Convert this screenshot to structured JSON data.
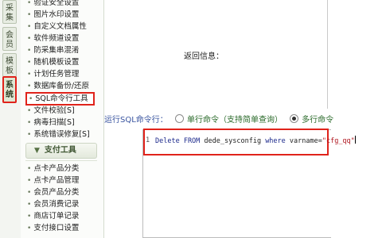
{
  "tabs": [
    {
      "label": "采集"
    },
    {
      "label": "会员"
    },
    {
      "label": "模板"
    },
    {
      "label": "系统",
      "active": true
    }
  ],
  "menu": {
    "system_items": [
      {
        "label": "验证安全设置"
      },
      {
        "label": "图片水印设置"
      },
      {
        "label": "自定义文档属性"
      },
      {
        "label": "软件频道设置"
      },
      {
        "label": "防采集串混淆"
      },
      {
        "label": "随机模板设置"
      },
      {
        "label": "计划任务管理"
      },
      {
        "label": "数据库备份/还原"
      },
      {
        "label": "SQL命令行工具",
        "highlighted": true
      },
      {
        "label": "文件校验[S]"
      },
      {
        "label": "病毒扫描[S]"
      },
      {
        "label": "系统错误修复[S]"
      }
    ],
    "group_title": "支付工具",
    "pay_items": [
      {
        "label": "点卡产品分类"
      },
      {
        "label": "点卡产品管理"
      },
      {
        "label": "会员产品分类"
      },
      {
        "label": "会员消费记录"
      },
      {
        "label": "商店订单记录"
      },
      {
        "label": "支付接口设置"
      }
    ]
  },
  "content": {
    "return_label": "返回信息：",
    "mode_label": "运行SQL命令行：",
    "mode_options": [
      {
        "label": "单行命令（支持简单查询）",
        "selected": false
      },
      {
        "label": "多行命令",
        "selected": true
      }
    ],
    "sql": {
      "line_number": "1",
      "kw1": "Delete FROM",
      "table": " dede_sysconfig ",
      "kw2": "where",
      "field": " varname=",
      "value": "\"cfg_qq\""
    }
  },
  "colors": {
    "highlight_red": "#e0231b",
    "sql_keyword": "#1d2a8c",
    "sql_string": "#b0161f"
  }
}
